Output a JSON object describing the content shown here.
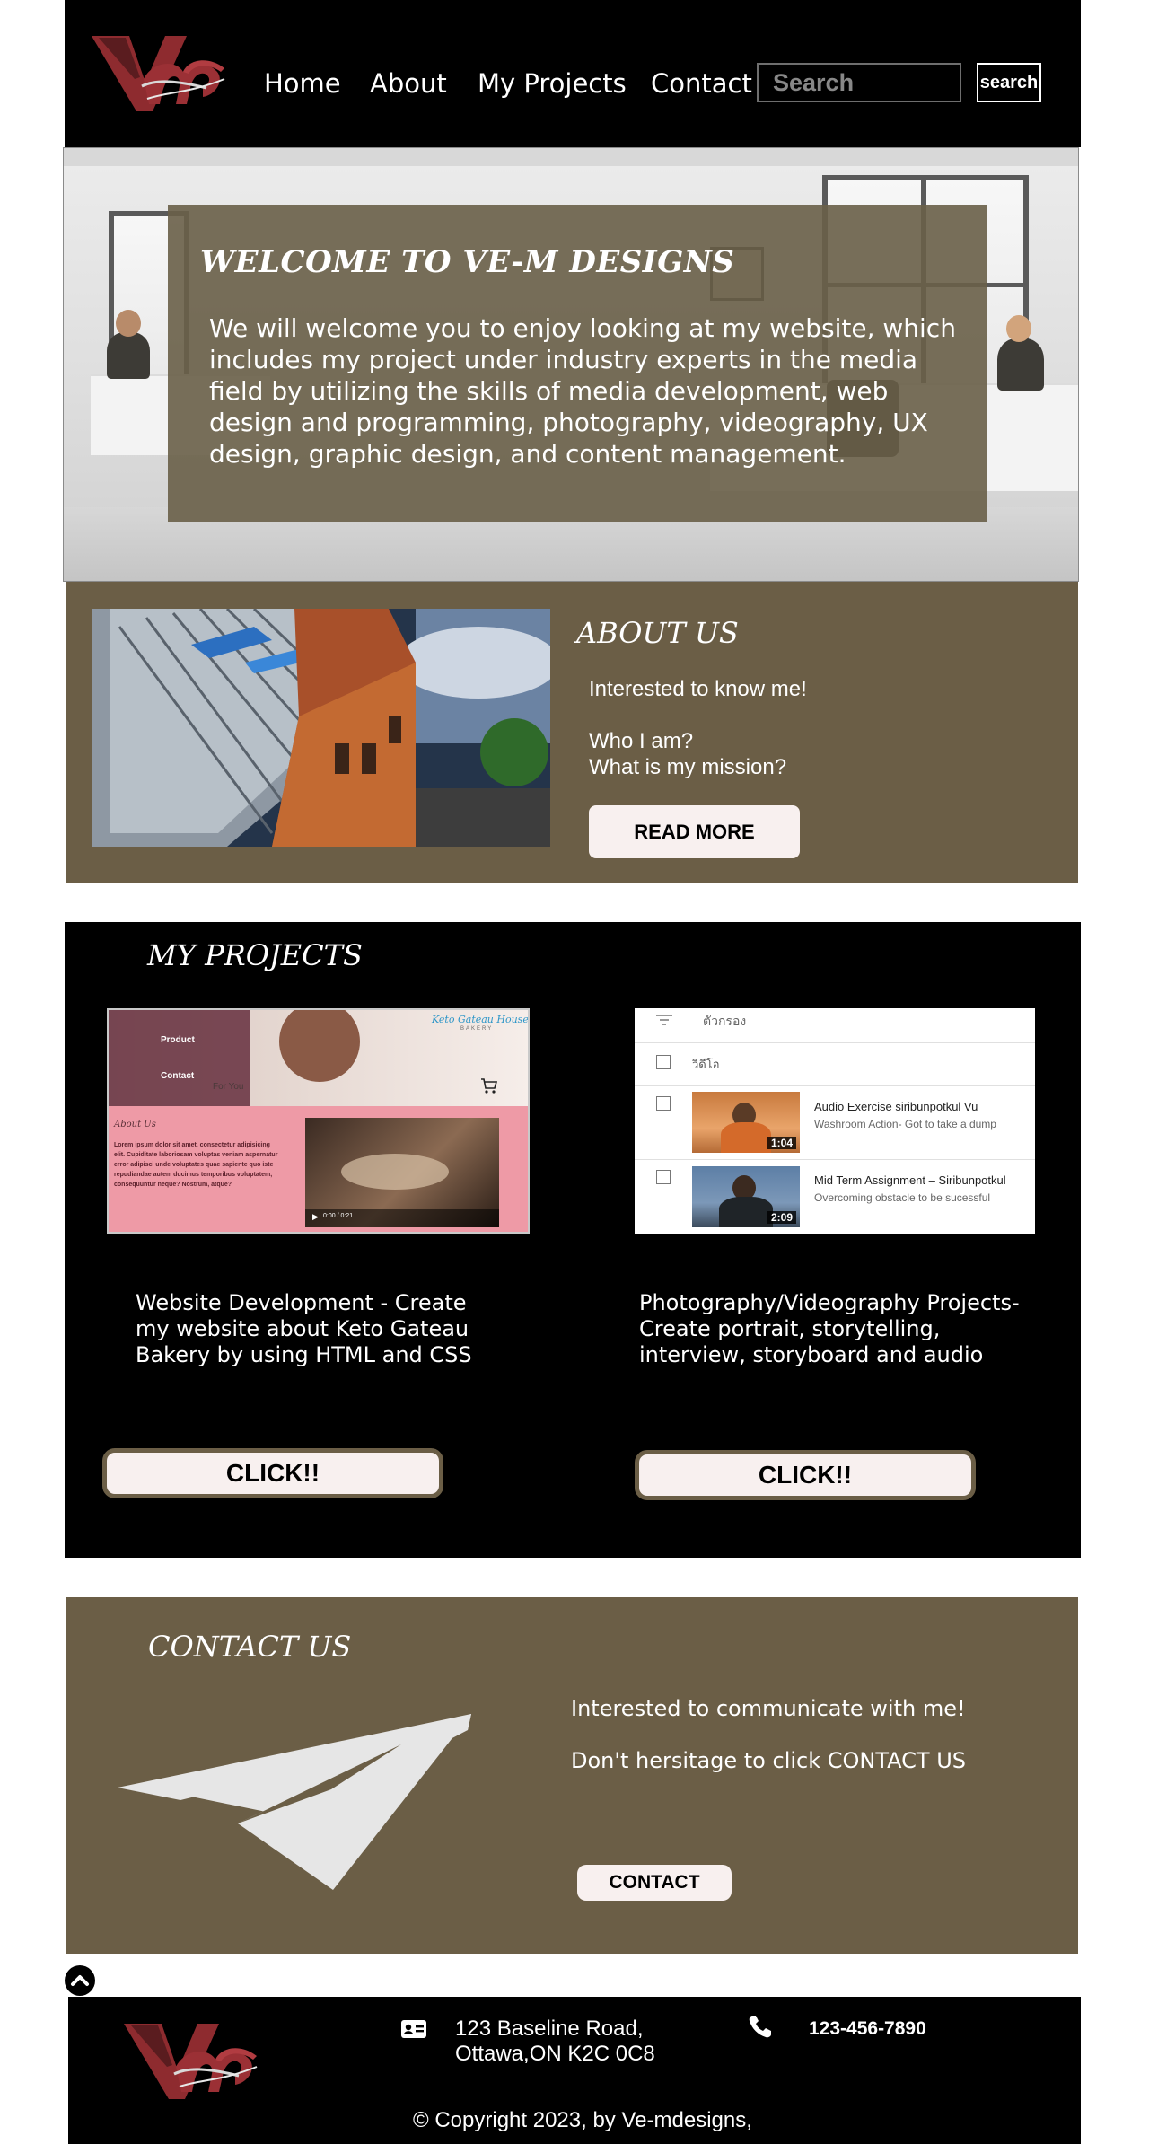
{
  "header": {
    "logo_text": "Ve-m",
    "nav": [
      {
        "label": "Home"
      },
      {
        "label": "About"
      },
      {
        "label": "My Projects"
      },
      {
        "label": "Contact"
      }
    ],
    "search": {
      "placeholder": "Search",
      "button_label": "search"
    }
  },
  "hero": {
    "title": "WELCOME  TO VE-M DESIGNS",
    "text": "We will welcome you to enjoy looking at my website, which includes my project under industry experts in the media field by utilizing the skills of media development, web design and programming, photography, videography, UX design, graphic design, and content management."
  },
  "about": {
    "title": "ABOUT US",
    "line1": "Interested to know me!",
    "line2": "Who I am?",
    "line3": "What is my mission?",
    "button_label": "READ MORE"
  },
  "projects": {
    "title": "MY PROJECTS",
    "project1": {
      "thumb": {
        "menu": [
          "Product",
          "Contact"
        ],
        "brand": "Keto Gateau House",
        "brand_sub": "BAKERY",
        "for_you": "For You",
        "section": "About Us",
        "body": "Lorem ipsum dolor sit amet, consectetur adipisicing elit. Cupiditate laboriosam voluptas veniam aspernatur error adipisci unde voluptates quae sapiente quo iste repudiandae autem ducimus temporibus voluptatem, consequuntur neque? Nostrum, atque?",
        "video_time": "0:00 / 0:21"
      },
      "description": "Website Development - Create my website about Keto Gateau Bakery by using HTML and CSS",
      "button_label": "CLICK!!"
    },
    "project2": {
      "thumb": {
        "filter_label": "ตัวกรอง",
        "column_label": "วิดีโอ",
        "videos": [
          {
            "title": "Audio Exercise siribunpotkul Vu",
            "subtitle": "Washroom Action- Got to take a dump",
            "duration": "1:04"
          },
          {
            "title": "Mid Term Assignment – Siribunpotkul",
            "subtitle": "Overcoming obstacle to be sucessful",
            "duration": "2:09"
          }
        ]
      },
      "description": "Photography/Videography Projects- Create portrait, storytelling, interview, storyboard and audio",
      "button_label": "CLICK!!"
    }
  },
  "contact": {
    "title": "CONTACT US",
    "line1": "Interested to communicate with me!",
    "line2": "Don't hersitage to click CONTACT US",
    "button_label": "CONTACT"
  },
  "footer": {
    "address_line1": "123 Baseline Road,",
    "address_line2": "Ottawa,ON K2C 0C8",
    "phone": "123-456-7890",
    "copyright": "©  Copyright 2023, by Ve-mdesigns,"
  },
  "colors": {
    "header_bg": "#000000",
    "brand_brown": "#6b5e46",
    "logo_red": "#8e2b2f",
    "button_bg": "#f8f0ef"
  },
  "icons": [
    "logo",
    "search-icon",
    "paper-plane-icon",
    "chevron-up-icon",
    "address-card-icon",
    "phone-icon",
    "play-icon",
    "cart-icon",
    "filter-icon"
  ]
}
